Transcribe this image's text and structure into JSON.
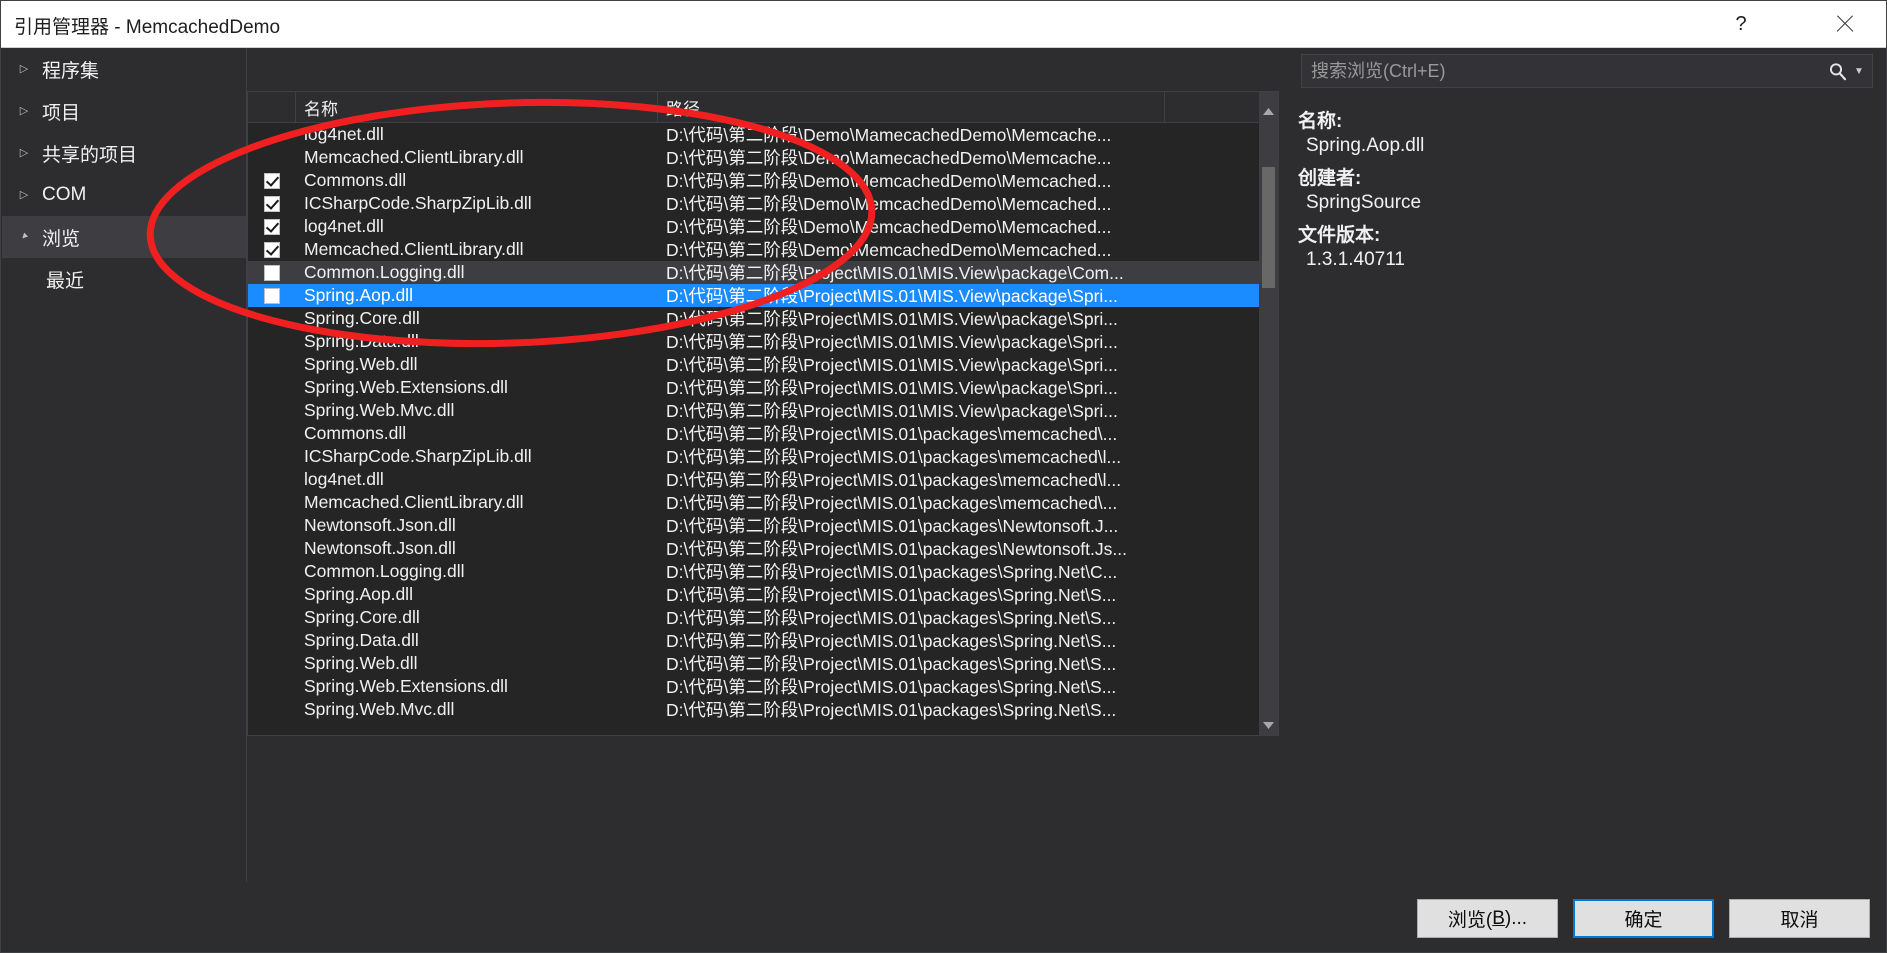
{
  "window": {
    "title": "引用管理器 - MemcachedDemo",
    "help_label": "?",
    "close_label": "✕"
  },
  "search": {
    "placeholder": "搜索浏览(Ctrl+E)",
    "value": "",
    "icon": "search-icon",
    "chevron": "▼"
  },
  "sidebar": {
    "items": [
      {
        "label": "程序集",
        "state": "collapsed",
        "selected": false,
        "child": false
      },
      {
        "label": "项目",
        "state": "collapsed",
        "selected": false,
        "child": false
      },
      {
        "label": "共享的项目",
        "state": "collapsed",
        "selected": false,
        "child": false
      },
      {
        "label": "COM",
        "state": "collapsed",
        "selected": false,
        "child": false
      },
      {
        "label": "浏览",
        "state": "expanded",
        "selected": true,
        "child": false
      },
      {
        "label": "最近",
        "state": "none",
        "selected": false,
        "child": true
      }
    ]
  },
  "list": {
    "columns": [
      "",
      "名称",
      "路径",
      ""
    ],
    "rows": [
      {
        "check": "none",
        "name": "log4net.dll",
        "path": "D:\\代码\\第二阶段\\Demo\\MamecachedDemo\\Memcache...",
        "state": "normal"
      },
      {
        "check": "none",
        "name": "Memcached.ClientLibrary.dll",
        "path": "D:\\代码\\第二阶段\\Demo\\MamecachedDemo\\Memcache...",
        "state": "normal"
      },
      {
        "check": "checked",
        "name": "Commons.dll",
        "path": "D:\\代码\\第二阶段\\Demo\\MemcachedDemo\\Memcached...",
        "state": "normal"
      },
      {
        "check": "checked",
        "name": "ICSharpCode.SharpZipLib.dll",
        "path": "D:\\代码\\第二阶段\\Demo\\MemcachedDemo\\Memcached...",
        "state": "normal"
      },
      {
        "check": "checked",
        "name": "log4net.dll",
        "path": "D:\\代码\\第二阶段\\Demo\\MemcachedDemo\\Memcached...",
        "state": "normal"
      },
      {
        "check": "checked",
        "name": "Memcached.ClientLibrary.dll",
        "path": "D:\\代码\\第二阶段\\Demo\\MemcachedDemo\\Memcached...",
        "state": "normal"
      },
      {
        "check": "unchecked",
        "name": "Common.Logging.dll",
        "path": "D:\\代码\\第二阶段\\Project\\MIS.01\\MIS.View\\package\\Com...",
        "state": "hover"
      },
      {
        "check": "unchecked",
        "name": "Spring.Aop.dll",
        "path": "D:\\代码\\第二阶段\\Project\\MIS.01\\MIS.View\\package\\Spri...",
        "state": "selected"
      },
      {
        "check": "none",
        "name": "Spring.Core.dll",
        "path": "D:\\代码\\第二阶段\\Project\\MIS.01\\MIS.View\\package\\Spri...",
        "state": "normal"
      },
      {
        "check": "none",
        "name": "Spring.Data.dll",
        "path": "D:\\代码\\第二阶段\\Project\\MIS.01\\MIS.View\\package\\Spri...",
        "state": "normal"
      },
      {
        "check": "none",
        "name": "Spring.Web.dll",
        "path": "D:\\代码\\第二阶段\\Project\\MIS.01\\MIS.View\\package\\Spri...",
        "state": "normal"
      },
      {
        "check": "none",
        "name": "Spring.Web.Extensions.dll",
        "path": "D:\\代码\\第二阶段\\Project\\MIS.01\\MIS.View\\package\\Spri...",
        "state": "normal"
      },
      {
        "check": "none",
        "name": "Spring.Web.Mvc.dll",
        "path": "D:\\代码\\第二阶段\\Project\\MIS.01\\MIS.View\\package\\Spri...",
        "state": "normal"
      },
      {
        "check": "none",
        "name": "Commons.dll",
        "path": "D:\\代码\\第二阶段\\Project\\MIS.01\\packages\\memcached\\...",
        "state": "normal"
      },
      {
        "check": "none",
        "name": "ICSharpCode.SharpZipLib.dll",
        "path": "D:\\代码\\第二阶段\\Project\\MIS.01\\packages\\memcached\\l...",
        "state": "normal"
      },
      {
        "check": "none",
        "name": "log4net.dll",
        "path": "D:\\代码\\第二阶段\\Project\\MIS.01\\packages\\memcached\\l...",
        "state": "normal"
      },
      {
        "check": "none",
        "name": "Memcached.ClientLibrary.dll",
        "path": "D:\\代码\\第二阶段\\Project\\MIS.01\\packages\\memcached\\...",
        "state": "normal"
      },
      {
        "check": "none",
        "name": "Newtonsoft.Json.dll",
        "path": "D:\\代码\\第二阶段\\Project\\MIS.01\\packages\\Newtonsoft.J...",
        "state": "normal"
      },
      {
        "check": "none",
        "name": "Newtonsoft.Json.dll",
        "path": "D:\\代码\\第二阶段\\Project\\MIS.01\\packages\\Newtonsoft.Js...",
        "state": "normal"
      },
      {
        "check": "none",
        "name": "Common.Logging.dll",
        "path": "D:\\代码\\第二阶段\\Project\\MIS.01\\packages\\Spring.Net\\C...",
        "state": "normal"
      },
      {
        "check": "none",
        "name": "Spring.Aop.dll",
        "path": "D:\\代码\\第二阶段\\Project\\MIS.01\\packages\\Spring.Net\\S...",
        "state": "normal"
      },
      {
        "check": "none",
        "name": "Spring.Core.dll",
        "path": "D:\\代码\\第二阶段\\Project\\MIS.01\\packages\\Spring.Net\\S...",
        "state": "normal"
      },
      {
        "check": "none",
        "name": "Spring.Data.dll",
        "path": "D:\\代码\\第二阶段\\Project\\MIS.01\\packages\\Spring.Net\\S...",
        "state": "normal"
      },
      {
        "check": "none",
        "name": "Spring.Web.dll",
        "path": "D:\\代码\\第二阶段\\Project\\MIS.01\\packages\\Spring.Net\\S...",
        "state": "normal"
      },
      {
        "check": "none",
        "name": "Spring.Web.Extensions.dll",
        "path": "D:\\代码\\第二阶段\\Project\\MIS.01\\packages\\Spring.Net\\S...",
        "state": "normal"
      },
      {
        "check": "none",
        "name": "Spring.Web.Mvc.dll",
        "path": "D:\\代码\\第二阶段\\Project\\MIS.01\\packages\\Spring.Net\\S...",
        "state": "normal"
      }
    ]
  },
  "detail": {
    "fields": [
      {
        "label": "名称:",
        "value": "Spring.Aop.dll"
      },
      {
        "label": "创建者:",
        "value": "SpringSource"
      },
      {
        "label": "文件版本:",
        "value": "1.3.1.40711"
      }
    ]
  },
  "buttons": {
    "browse": {
      "label_prefix": "浏览(",
      "accel": "B",
      "label_suffix": ")..."
    },
    "ok": "确定",
    "cancel": "取消"
  },
  "colors": {
    "selection_blue": "#1a8cff",
    "annotation_red": "#f02020",
    "window_bg": "#2d2d30",
    "list_bg": "#252526"
  },
  "annotation": {
    "shape": "ellipse",
    "color": "#f02020"
  }
}
